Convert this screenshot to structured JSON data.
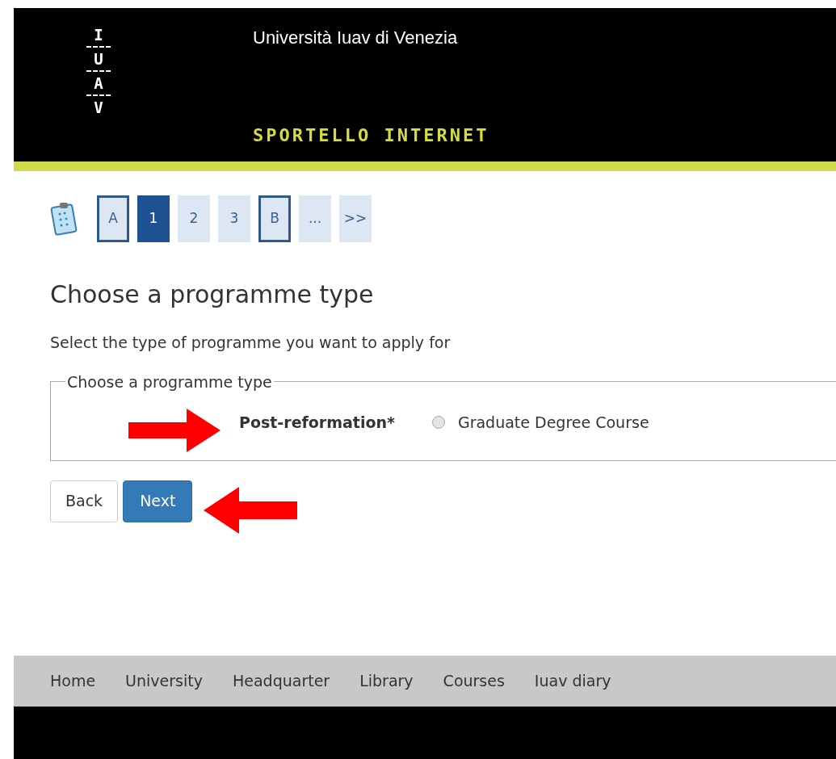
{
  "header": {
    "logo_letters": [
      "I",
      "U",
      "A",
      "V"
    ],
    "university": "Università Iuav di Venezia",
    "service": "SPORTELLO INTERNET"
  },
  "steps": [
    {
      "label": "A",
      "kind": "marker",
      "selected": false
    },
    {
      "label": "1",
      "kind": "number",
      "selected": true
    },
    {
      "label": "2",
      "kind": "number",
      "selected": false
    },
    {
      "label": "3",
      "kind": "number",
      "selected": false
    },
    {
      "label": "B",
      "kind": "marker",
      "selected": false
    },
    {
      "label": "...",
      "kind": "number",
      "selected": false
    },
    {
      "label": ">>",
      "kind": "number",
      "selected": false
    }
  ],
  "title": "Choose a programme type",
  "instruction": "Select the type of programme you want to apply for",
  "fieldset": {
    "legend": "Choose a programme type",
    "group_label": "Post-reformation*",
    "options": [
      {
        "label": "Graduate Degree Course",
        "checked": false
      }
    ]
  },
  "buttons": [
    {
      "label": "Back",
      "kind": "secondary"
    },
    {
      "label": "Next",
      "kind": "primary"
    }
  ],
  "footer_links": [
    "Home",
    "University",
    "Headquarter",
    "Library",
    "Courses",
    "Iuav diary"
  ]
}
